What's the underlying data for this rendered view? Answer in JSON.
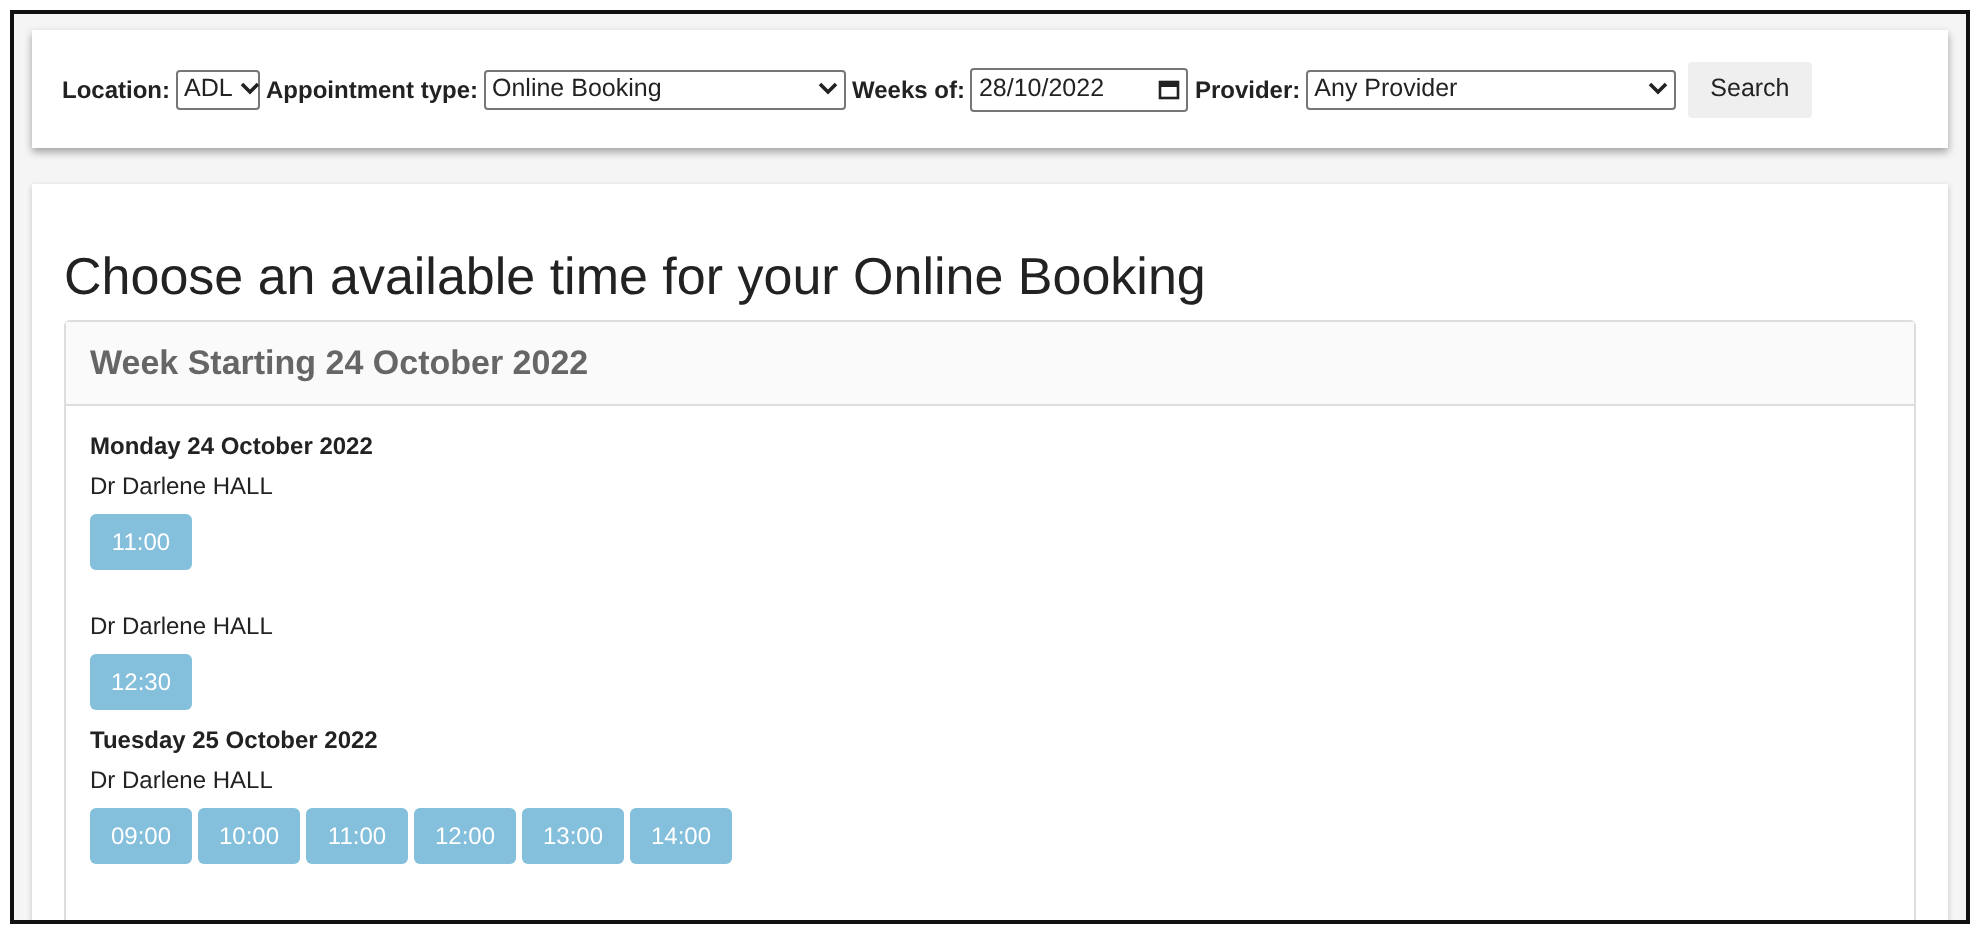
{
  "filters": {
    "location": {
      "label": "Location:",
      "value": "ADL"
    },
    "appointment_type": {
      "label": "Appointment type:",
      "value": "Online Booking"
    },
    "weeks_of": {
      "label": "Weeks of:",
      "value": "28/10/2022"
    },
    "provider": {
      "label": "Provider:",
      "value": "Any Provider"
    },
    "search_button": "Search"
  },
  "title": "Choose an available time for your Online Booking",
  "week": {
    "heading": "Week Starting 24 October 2022",
    "days": [
      {
        "date": "Monday 24 October 2022",
        "groups": [
          {
            "provider": "Dr Darlene HALL",
            "slots": [
              "11:00"
            ]
          },
          {
            "provider": "Dr Darlene HALL",
            "slots": [
              "12:30"
            ]
          }
        ]
      },
      {
        "date": "Tuesday 25 October 2022",
        "groups": [
          {
            "provider": "Dr Darlene HALL",
            "slots": [
              "09:00",
              "10:00",
              "11:00",
              "12:00",
              "13:00",
              "14:00"
            ]
          }
        ]
      }
    ]
  }
}
